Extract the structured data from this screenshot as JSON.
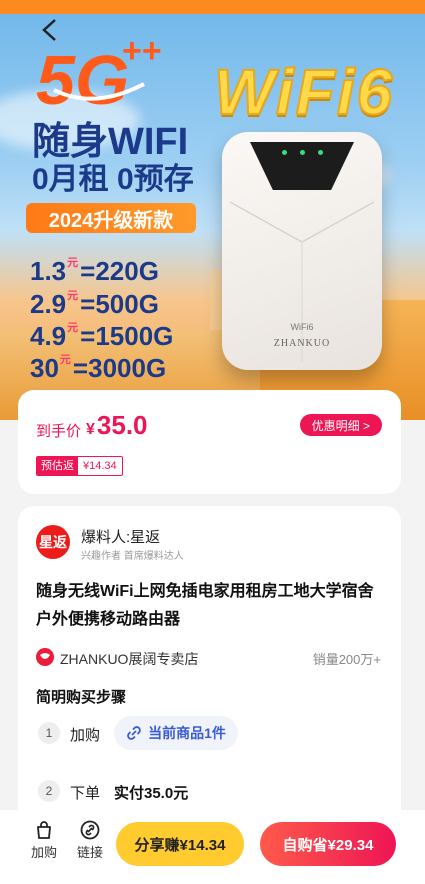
{
  "hero": {
    "logo_text": "5G++",
    "wifi6": "WiFi6",
    "headline": "随身WIFI",
    "subheadline": "0月租 0预存",
    "tag": "2024升级新款",
    "plans": [
      {
        "price": "1.3",
        "unit": "元",
        "data": "=220G"
      },
      {
        "price": "2.9",
        "unit": "元",
        "data": "=500G"
      },
      {
        "price": "4.9",
        "unit": "元",
        "data": "=1500G"
      },
      {
        "price": "30",
        "unit": "元",
        "data": "=3000G"
      }
    ],
    "device_label": "WiFi6",
    "device_brand": "ZHANKUO"
  },
  "price_card": {
    "label": "到手价",
    "currency": "¥",
    "price": "35.0",
    "promo_button": "优惠明细 >",
    "rebate_key": "预估返",
    "rebate_value": "¥14.34"
  },
  "detail": {
    "avatar_text": "星返",
    "poster": "爆料人:星返",
    "poster_sub": "兴趣作者 首席爆料达人",
    "title": "随身无线WiFi上网免插电家用租房工地大学宿舍户外便携移动路由器",
    "shop": "ZHANKUO展阔专卖店",
    "sales": "销量200万+",
    "steps_heading": "简明购买步骤",
    "steps": [
      {
        "num": "1",
        "text": "加购",
        "chip": "当前商品1件"
      },
      {
        "num": "2",
        "text": "下单",
        "bold": "实付35.0元"
      }
    ]
  },
  "bottom_bar": {
    "cart_label": "加购",
    "link_label": "链接",
    "share_button": "分享赚¥14.34",
    "buy_button": "自购省¥29.34"
  },
  "colors": {
    "accent": "#ee1555",
    "yellow": "#ffcb2e",
    "navy": "#1c3a8a",
    "orange": "#ff8a1f"
  }
}
